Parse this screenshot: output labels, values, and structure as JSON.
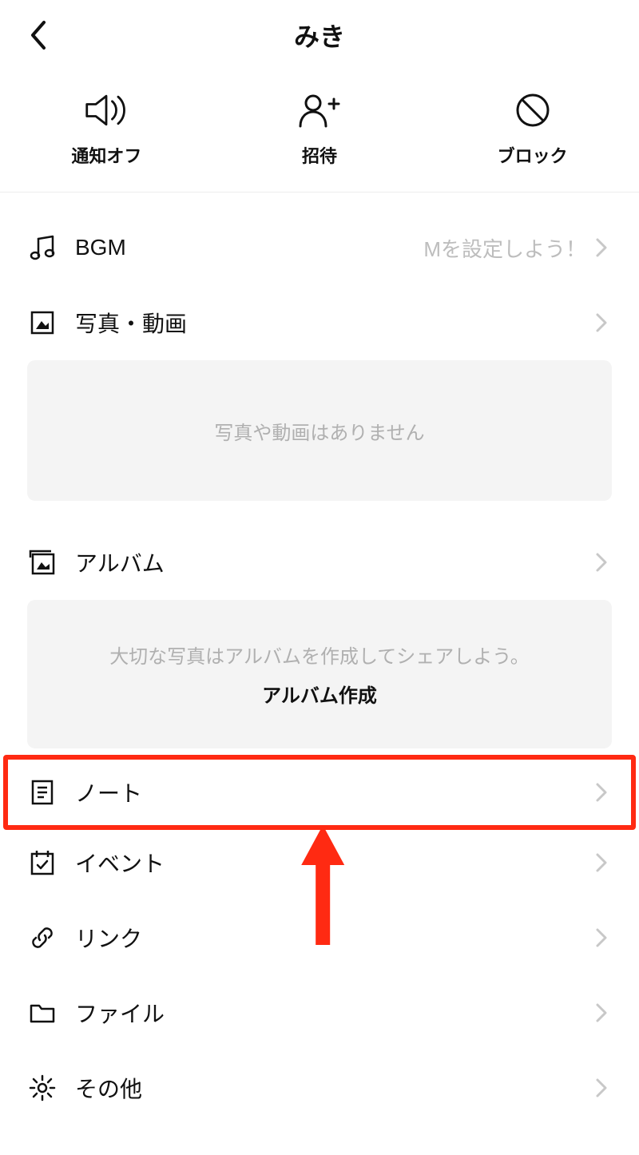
{
  "header": {
    "title": "みき"
  },
  "actions": {
    "notification_off": "通知オフ",
    "invite": "招待",
    "block": "ブロック"
  },
  "rows": {
    "bgm": {
      "label": "BGM",
      "hint": "Mを設定しよう！"
    },
    "photos": {
      "label": "写真・動画",
      "empty": "写真や動画はありません"
    },
    "album": {
      "label": "アルバム",
      "empty_hint": "大切な写真はアルバムを作成してシェアしよう。",
      "cta": "アルバム作成"
    },
    "note": {
      "label": "ノート"
    },
    "event": {
      "label": "イベント"
    },
    "link": {
      "label": "リンク"
    },
    "file": {
      "label": "ファイル"
    },
    "other": {
      "label": "その他"
    }
  },
  "annotation": {
    "color": "#ff2a12"
  }
}
